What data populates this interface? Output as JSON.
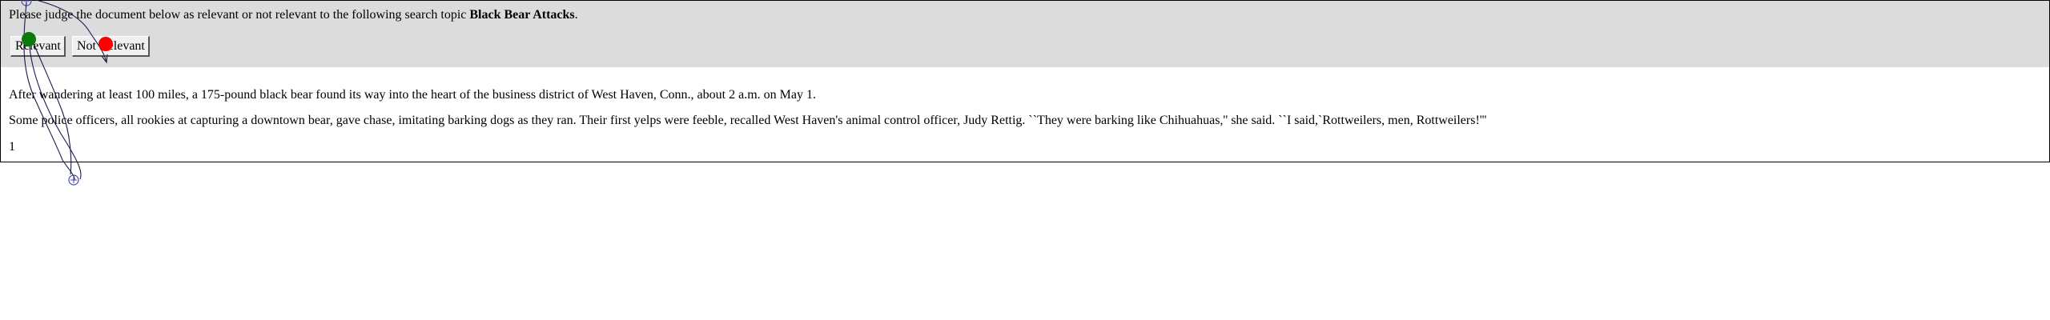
{
  "prompt": {
    "prefix": "Please judge the document below as relevant or not relevant to the following search topic ",
    "topic": "Black Bear Attacks",
    "suffix": "."
  },
  "buttons": {
    "relevant_label": "Relevant",
    "not_relevant_label": "Not Relevant"
  },
  "document": {
    "paragraphs": [
      "After wandering at least 100 miles, a 175-pound black bear found its way into the heart of the business district of West Haven, Conn., about 2 a.m. on May 1.",
      "Some police officers, all rookies at capturing a downtown bear, gave chase, imitating barking dogs as they ran. Their first yelps were feeble, recalled West Haven's animal control officer, Judy Rettig. ``They were barking like Chihuahuas,'' she said. ``I said,`Rottweilers, men, Rottweilers!'''",
      "1"
    ]
  },
  "overlay": {
    "green_marker_color": "#0a7a0a",
    "red_marker_color": "#ff0000",
    "trace_color": "#1a1a4a",
    "target_icon_color": "#4a4aa8"
  }
}
